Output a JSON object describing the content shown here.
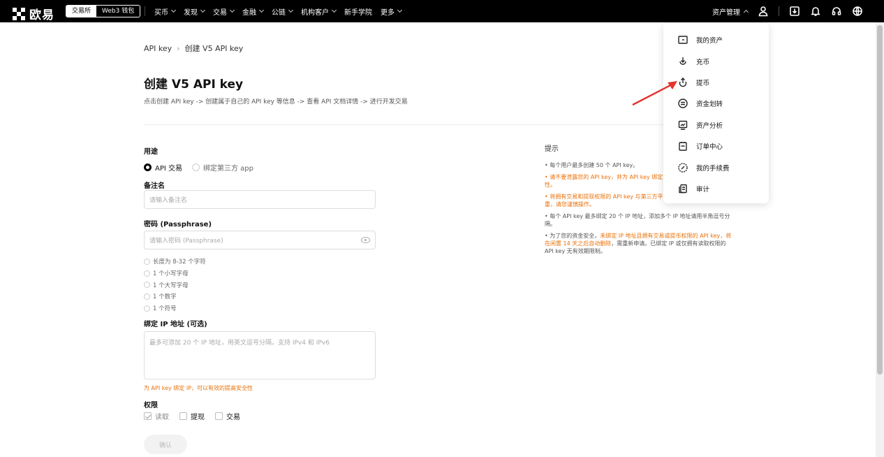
{
  "header": {
    "logo_text": "欧易",
    "segment": {
      "exchange": "交易所",
      "wallet": "Web3 钱包"
    },
    "nav": [
      "买币",
      "发现",
      "交易",
      "金融",
      "公链",
      "机构客户",
      "新手学院",
      "更多"
    ],
    "assets_label": "资产管理"
  },
  "breadcrumb": {
    "root": "API key",
    "sep": "›",
    "current": "创建 V5 API key"
  },
  "page": {
    "title": "创建 V5 API key",
    "desc": "点击创建 API key -> 创建属于自己的 API key 等信息 -> 查看 API 文档详情 -> 进行开发交易"
  },
  "form": {
    "usage_label": "用途",
    "usage_options": [
      "API 交易",
      "绑定第三方 app"
    ],
    "remark_label": "备注名",
    "remark_placeholder": "请输入备注名",
    "password_label": "密码 (Passphrase)",
    "password_placeholder": "请输入密码 (Passphrase)",
    "password_rules": [
      "长度为 8-32 个字符",
      "1 个小写字母",
      "1 个大写字母",
      "1 个数字",
      "1 个符号"
    ],
    "ip_label": "绑定 IP 地址 (可选)",
    "ip_placeholder": "最多可添加 20 个 IP 地址，用英文逗号分隔，支持 IPv4 和 IPv6",
    "ip_warning": "为 API key 绑定 IP，可以有效的提高安全性",
    "perm_label": "权限",
    "perms": [
      "读取",
      "提现",
      "交易"
    ],
    "confirm_label": "确认"
  },
  "tips": {
    "title": "提示",
    "t1": "• 每个用户最多创建 50 个 API key。",
    "t2": "• 请不要泄露您的 API key，并为 API key 绑定",
    "t2b": "性。",
    "t3": "• 将拥有交易和提现权限的 API key 与第三方平",
    "t3b": "重，请您谨慎操作。",
    "t4": "• 每个 API key 最多绑定 20 个 IP 地址，添加多个 IP 地址请用半角逗号分隔。",
    "t5a": "• 为了您的资金安全，",
    "t5b": "未绑定 IP 地址且拥有交易或提币权限的 API key，将在闲置 14 天之后自动删除",
    "t5c": "，需重新申请。已绑定 IP 或仅拥有读取权限的 API key 无有效期限制。"
  },
  "dropdown": {
    "items": [
      "我的资产",
      "充币",
      "提币",
      "资金划转",
      "资产分析",
      "订单中心",
      "我的手续费",
      "审计"
    ]
  },
  "colors": {
    "accent_orange": "#e8710a",
    "annotation_red": "#e3342f",
    "topbar": "#000000"
  }
}
